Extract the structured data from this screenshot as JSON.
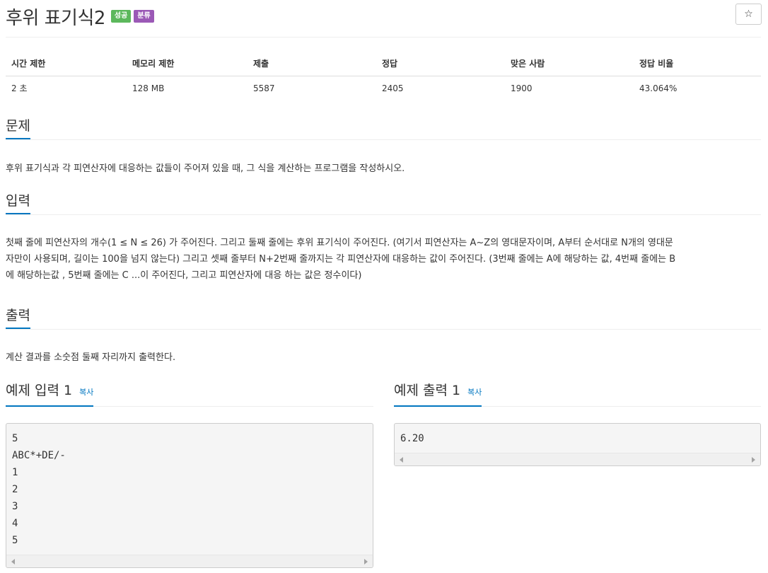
{
  "problem": {
    "title": "후위 표기식2",
    "badges": {
      "success": "성공",
      "category": "분류"
    },
    "star_icon": "☆"
  },
  "info_table": {
    "headers": [
      "시간 제한",
      "메모리 제한",
      "제출",
      "정답",
      "맞은 사람",
      "정답 비율"
    ],
    "values": [
      "2 초",
      "128 MB",
      "5587",
      "2405",
      "1900",
      "43.064%"
    ]
  },
  "sections": {
    "description": {
      "title": "문제",
      "text": "후위 표기식과 각 피연산자에 대응하는 값들이 주어져 있을 때, 그 식을 계산하는 프로그램을 작성하시오."
    },
    "input": {
      "title": "입력",
      "line1": "첫째 줄에 피연산자의 개수(1 ≤ N ≤ 26) 가 주어진다. 그리고 둘째 줄에는 후위 표기식이 주어진다. (여기서 피연산자는 A~Z의 영대문자이며, A부터 순서대로 N개의 영대문",
      "line2": "자만이 사용되며, 길이는 100을 넘지 않는다) 그리고 셋째 줄부터 N+2번째 줄까지는 각 피연산자에 대응하는 값이 주어진다. (3번째 줄에는 A에 해당하는 값, 4번째 줄에는 B",
      "line3": "에 해당하는값 , 5번째 줄에는 C ...이 주어진다, 그리고 피연산자에 대응 하는 값은 정수이다)"
    },
    "output": {
      "title": "출력",
      "text": "계산 결과를 소숫점 둘째 자리까지 출력한다."
    }
  },
  "samples": {
    "input": {
      "title": "예제 입력 1",
      "copy_label": "복사",
      "content": "5\nABC*+DE/-\n1\n2\n3\n4\n5"
    },
    "output": {
      "title": "예제 출력 1",
      "copy_label": "복사",
      "content": "6.20"
    }
  }
}
